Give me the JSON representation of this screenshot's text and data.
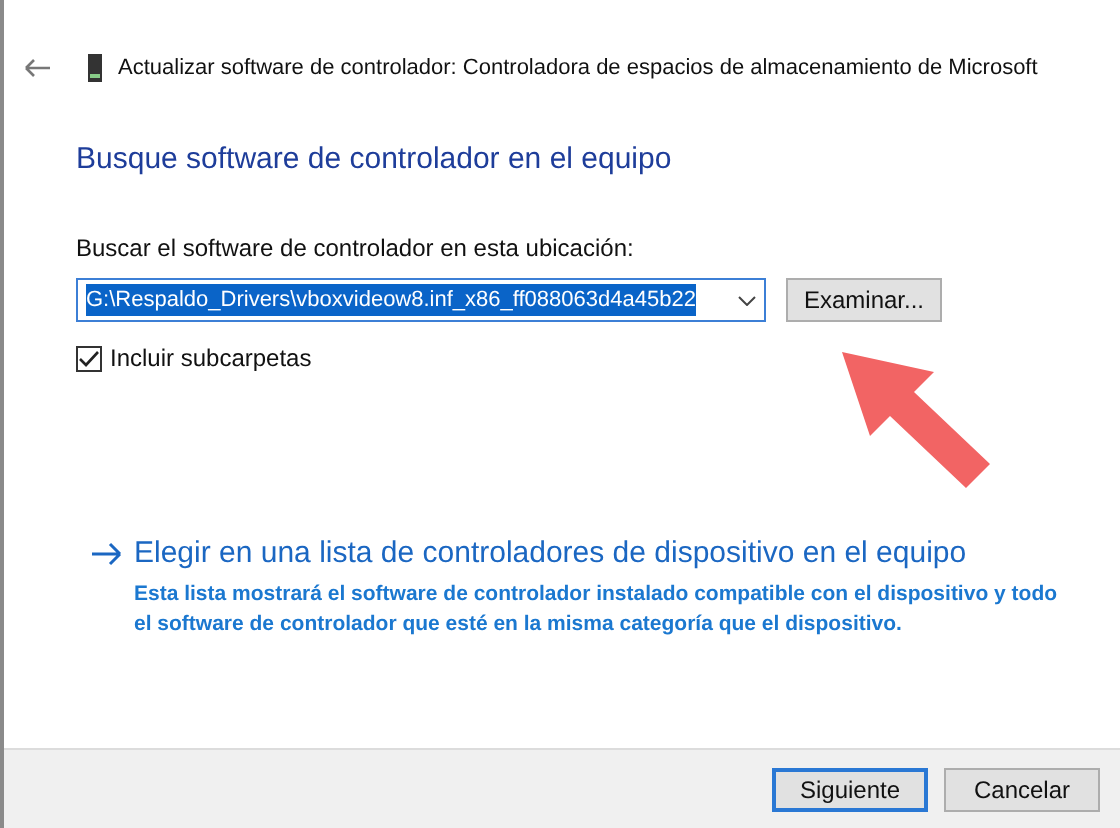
{
  "window": {
    "title": "Actualizar software de controlador: Controladora de espacios de almacenamiento de Microsoft"
  },
  "heading": "Busque software de controlador en el equipo",
  "location": {
    "label": "Buscar el software de controlador en esta ubicación:",
    "value": "G:\\Respaldo_Drivers\\vboxvideow8.inf_x86_ff088063d4a45b22",
    "selected": true
  },
  "browse_button": "Examinar...",
  "include_subfolders": {
    "label": "Incluir subcarpetas",
    "checked": true
  },
  "choose_option": {
    "label": "Elegir en una lista de controladores de dispositivo en el equipo",
    "description": "Esta lista mostrará el software de controlador instalado compatible con el dispositivo y todo el software de controlador que esté en la misma categoría que el dispositivo."
  },
  "buttons": [
    {
      "label": "Siguiente",
      "default": true
    },
    {
      "label": "Cancelar",
      "default": false
    }
  ]
}
